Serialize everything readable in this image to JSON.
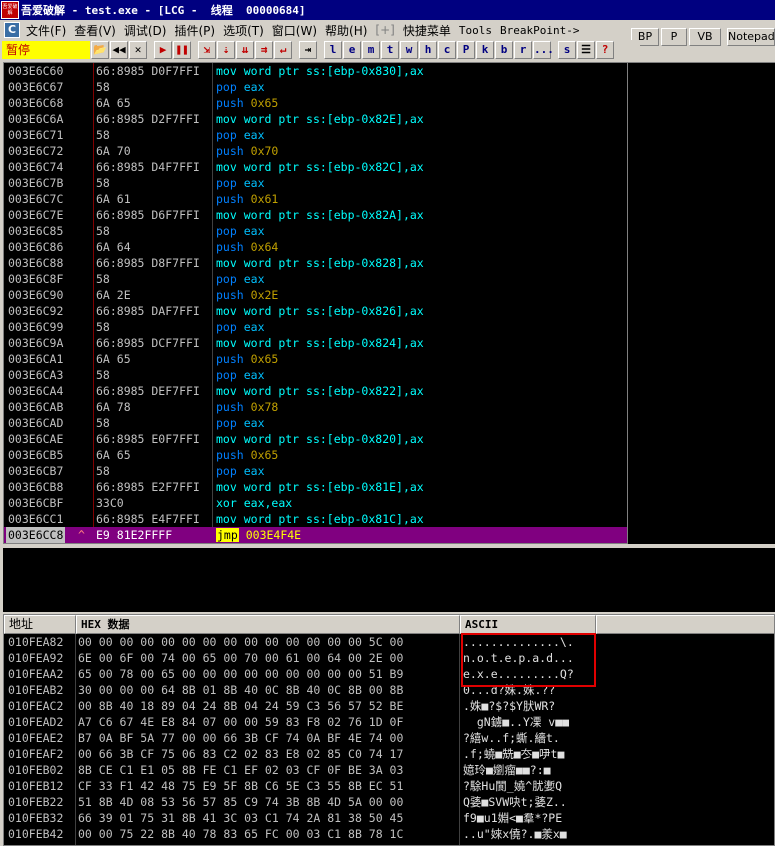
{
  "titlebar": {
    "logo_text": "吾爱破解",
    "app_name": "吾爱破解",
    "title_rest": " - test.exe - [LCG -  ",
    "thread_label": "线程",
    "thread_id": "  00000684]"
  },
  "menubar": {
    "icon": "C",
    "items": [
      {
        "label": "文件(F)"
      },
      {
        "label": "查看(V)"
      },
      {
        "label": "调试(D)"
      },
      {
        "label": "插件(P)"
      },
      {
        "label": "选项(T)"
      },
      {
        "label": "窗口(W)"
      },
      {
        "label": "帮助(H)"
      },
      {
        "label": "[+]"
      },
      {
        "label": "快捷菜单"
      },
      {
        "label": "Tools"
      },
      {
        "label": "BreakPoint->"
      }
    ],
    "right_buttons": [
      "BP",
      "P",
      "VB",
      "Notepad"
    ]
  },
  "toolbar": {
    "status": "暂停",
    "buttons": [
      "📂",
      "◀◀",
      "✕",
      "▶",
      "❚❚",
      "⇲",
      "⇣",
      "⇊",
      "⇉",
      "↵",
      "⇥",
      "l",
      "e",
      "m",
      "t",
      "w",
      "h",
      "c",
      "P",
      "k",
      "b",
      "r",
      "...",
      "s",
      "☰",
      "?"
    ]
  },
  "disasm": {
    "rows": [
      {
        "addr": "003E6C60",
        "mark": "",
        "bytes": "66:8985 D0F7FFI",
        "mn": "mov",
        "ops": "word ptr ss:[ebp-0x830],ax"
      },
      {
        "addr": "003E6C67",
        "mark": "",
        "bytes": "58",
        "mn": "pop",
        "ops": "eax"
      },
      {
        "addr": "003E6C68",
        "mark": "",
        "bytes": "6A 65",
        "mn": "push",
        "ops": "0x65"
      },
      {
        "addr": "003E6C6A",
        "mark": "",
        "bytes": "66:8985 D2F7FFI",
        "mn": "mov",
        "ops": "word ptr ss:[ebp-0x82E],ax"
      },
      {
        "addr": "003E6C71",
        "mark": "",
        "bytes": "58",
        "mn": "pop",
        "ops": "eax"
      },
      {
        "addr": "003E6C72",
        "mark": "",
        "bytes": "6A 70",
        "mn": "push",
        "ops": "0x70"
      },
      {
        "addr": "003E6C74",
        "mark": "",
        "bytes": "66:8985 D4F7FFI",
        "mn": "mov",
        "ops": "word ptr ss:[ebp-0x82C],ax"
      },
      {
        "addr": "003E6C7B",
        "mark": "",
        "bytes": "58",
        "mn": "pop",
        "ops": "eax"
      },
      {
        "addr": "003E6C7C",
        "mark": "",
        "bytes": "6A 61",
        "mn": "push",
        "ops": "0x61"
      },
      {
        "addr": "003E6C7E",
        "mark": "",
        "bytes": "66:8985 D6F7FFI",
        "mn": "mov",
        "ops": "word ptr ss:[ebp-0x82A],ax"
      },
      {
        "addr": "003E6C85",
        "mark": "",
        "bytes": "58",
        "mn": "pop",
        "ops": "eax"
      },
      {
        "addr": "003E6C86",
        "mark": "",
        "bytes": "6A 64",
        "mn": "push",
        "ops": "0x64"
      },
      {
        "addr": "003E6C88",
        "mark": "",
        "bytes": "66:8985 D8F7FFI",
        "mn": "mov",
        "ops": "word ptr ss:[ebp-0x828],ax"
      },
      {
        "addr": "003E6C8F",
        "mark": "",
        "bytes": "58",
        "mn": "pop",
        "ops": "eax"
      },
      {
        "addr": "003E6C90",
        "mark": "",
        "bytes": "6A 2E",
        "mn": "push",
        "ops": "0x2E"
      },
      {
        "addr": "003E6C92",
        "mark": "",
        "bytes": "66:8985 DAF7FFI",
        "mn": "mov",
        "ops": "word ptr ss:[ebp-0x826],ax"
      },
      {
        "addr": "003E6C99",
        "mark": "",
        "bytes": "58",
        "mn": "pop",
        "ops": "eax"
      },
      {
        "addr": "003E6C9A",
        "mark": "",
        "bytes": "66:8985 DCF7FFI",
        "mn": "mov",
        "ops": "word ptr ss:[ebp-0x824],ax"
      },
      {
        "addr": "003E6CA1",
        "mark": "",
        "bytes": "6A 65",
        "mn": "push",
        "ops": "0x65"
      },
      {
        "addr": "003E6CA3",
        "mark": "",
        "bytes": "58",
        "mn": "pop",
        "ops": "eax"
      },
      {
        "addr": "003E6CA4",
        "mark": "",
        "bytes": "66:8985 DEF7FFI",
        "mn": "mov",
        "ops": "word ptr ss:[ebp-0x822],ax"
      },
      {
        "addr": "003E6CAB",
        "mark": "",
        "bytes": "6A 78",
        "mn": "push",
        "ops": "0x78"
      },
      {
        "addr": "003E6CAD",
        "mark": "",
        "bytes": "58",
        "mn": "pop",
        "ops": "eax"
      },
      {
        "addr": "003E6CAE",
        "mark": "",
        "bytes": "66:8985 E0F7FFI",
        "mn": "mov",
        "ops": "word ptr ss:[ebp-0x820],ax"
      },
      {
        "addr": "003E6CB5",
        "mark": "",
        "bytes": "6A 65",
        "mn": "push",
        "ops": "0x65"
      },
      {
        "addr": "003E6CB7",
        "mark": "",
        "bytes": "58",
        "mn": "pop",
        "ops": "eax"
      },
      {
        "addr": "003E6CB8",
        "mark": "",
        "bytes": "66:8985 E2F7FFI",
        "mn": "mov",
        "ops": "word ptr ss:[ebp-0x81E],ax"
      },
      {
        "addr": "003E6CBF",
        "mark": "",
        "bytes": "33C0",
        "mn": "xor",
        "ops": "eax,eax"
      },
      {
        "addr": "003E6CC1",
        "mark": "",
        "bytes": "66:8985 E4F7FFI",
        "mn": "mov",
        "ops": "word ptr ss:[ebp-0x81C],ax"
      },
      {
        "addr": "003E6CC8",
        "mark": "^",
        "bytes": "E9 81E2FFFF",
        "mn": "jmp",
        "ops": "003E4F4E",
        "selected": true
      }
    ]
  },
  "dump": {
    "headers": [
      "地址",
      "HEX 数据",
      "ASCII"
    ],
    "rows": [
      {
        "addr": "010FEA82",
        "hex": "00 00 00 00 00 00 00 00 00 00 00 00 00 00 5C 00",
        "ascii": "..............\\."
      },
      {
        "addr": "010FEA92",
        "hex": "6E 00 6F 00 74 00 65 00 70 00 61 00 64 00 2E 00",
        "ascii": "n.o.t.e.p.a.d..."
      },
      {
        "addr": "010FEAA2",
        "hex": "65 00 78 00 65 00 00 00 00 00 00 00 00 00 51 B9",
        "ascii": "e.x.e.........Q?"
      },
      {
        "addr": "010FEAB2",
        "hex": "30 00 00 00 64 8B 01 8B 40 0C 8B 40 0C 8B 00 8B",
        "ascii": "0...d?姝.姝.??"
      },
      {
        "addr": "010FEAC2",
        "hex": "00 8B 40 18 89 04 24 8B 04 24 59 C3 56 57 52 BE",
        "ascii": ".姝■?$?$Y肰WR?"
      },
      {
        "addr": "010FEAD2",
        "hex": "A7 C6 67 4E E8 84 07 00 00 59 83 F8 02 76 1D 0F",
        "ascii": "  gN鐪■..Y凓 v■■"
      },
      {
        "addr": "010FEAE2",
        "hex": "B7 0A BF 5A 77 00 00 66 3B CF 74 0A BF 4E 74 00",
        "ascii": "?繥w..f;蟖.繬t."
      },
      {
        "addr": "010FEAF2",
        "hex": "00 66 3B CF 75 06 83 C2 02 83 E8 02 85 C0 74 17",
        "ascii": ".f;蟯■兟■冭■吚t■"
      },
      {
        "addr": "010FEB02",
        "hex": "8B CE C1 E1 05 8B FE C1 EF 02 03 CF 0F BE 3A 03",
        "ascii": "嬑玲■嬼瘤■■?:■"
      },
      {
        "addr": "010FEB12",
        "hex": "CF 33 F1 42 48 75 E9 5F 8B C6 5E C3 55 8B EC 51",
        "ascii": "?駼Hu閬_嬈^肬嬱Q"
      },
      {
        "addr": "010FEB22",
        "hex": "51 8B 4D 08 53 56 57 85 C9 74 3B 8B 4D 5A 00 00",
        "ascii": "Q婱■SVW吷t;婱Z.."
      },
      {
        "addr": "010FEB32",
        "hex": "66 39 01 75 31 8B 41 3C 03 C1 74 2A 81 38 50 45",
        "ascii": "f9■u1婣<■羣*?PE"
      },
      {
        "addr": "010FEB42",
        "hex": "00 00 75 22 8B 40 78 83 65 FC 00 03 C1 8B 78 1C",
        "ascii": "..u\"婡x僥?.■羕x■"
      }
    ]
  }
}
